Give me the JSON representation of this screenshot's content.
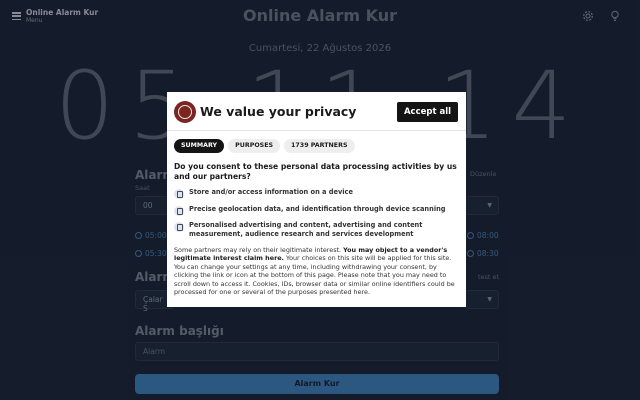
{
  "app": {
    "menu_title": "Online Alarm Kur",
    "menu_sub": "Menu",
    "title": "Online Alarm Kur",
    "date": "Cumartesi, 22 Ağustos 2026",
    "clock": "05 11 14"
  },
  "form": {
    "alarm_section": "Alarm",
    "hour_label": "Saat",
    "hour_value": "00",
    "edit_label": "Düzenle",
    "presets_left": [
      "05:00",
      "05:30"
    ],
    "presets_right": [
      "08:00",
      "08:30"
    ],
    "sound_section": "Alarm",
    "test_label": "test et",
    "sound_value": "Çalar S",
    "title_section": "Alarm başlığı",
    "title_placeholder": "Alarm",
    "submit_label": "Alarm Kur"
  },
  "consent": {
    "title": "We value your privacy",
    "accept_label": "Accept all",
    "tabs": [
      "SUMMARY",
      "PURPOSES",
      "1739 PARTNERS"
    ],
    "question": "Do you consent to these personal data processing activities by us and our partners?",
    "purposes": [
      "Store and/or access information on a device",
      "Precise geolocation data, and identification through device scanning",
      "Personalised advertising and content, advertising and content measurement, audience research and services development"
    ],
    "notice_part1": "Some partners may rely on their legitimate interest. ",
    "notice_bold": "You may object to a vendor's legitimate interest claim here.",
    "notice_part2": " Your choices on this site will be applied for this site. You can change your settings at any time, including withdrawing your consent, by clicking the link or icon at the bottom of this page. Please note that you may need to scroll down to access it. Cookies, IDs, browser data or similar online identifiers could be processed for one or several of the purposes presented here."
  },
  "icons": {
    "menu": "hamburger-icon",
    "settings": "gear-icon",
    "theme": "lightbulb-icon",
    "preset": "clock-icon",
    "logo": "site-logo"
  }
}
